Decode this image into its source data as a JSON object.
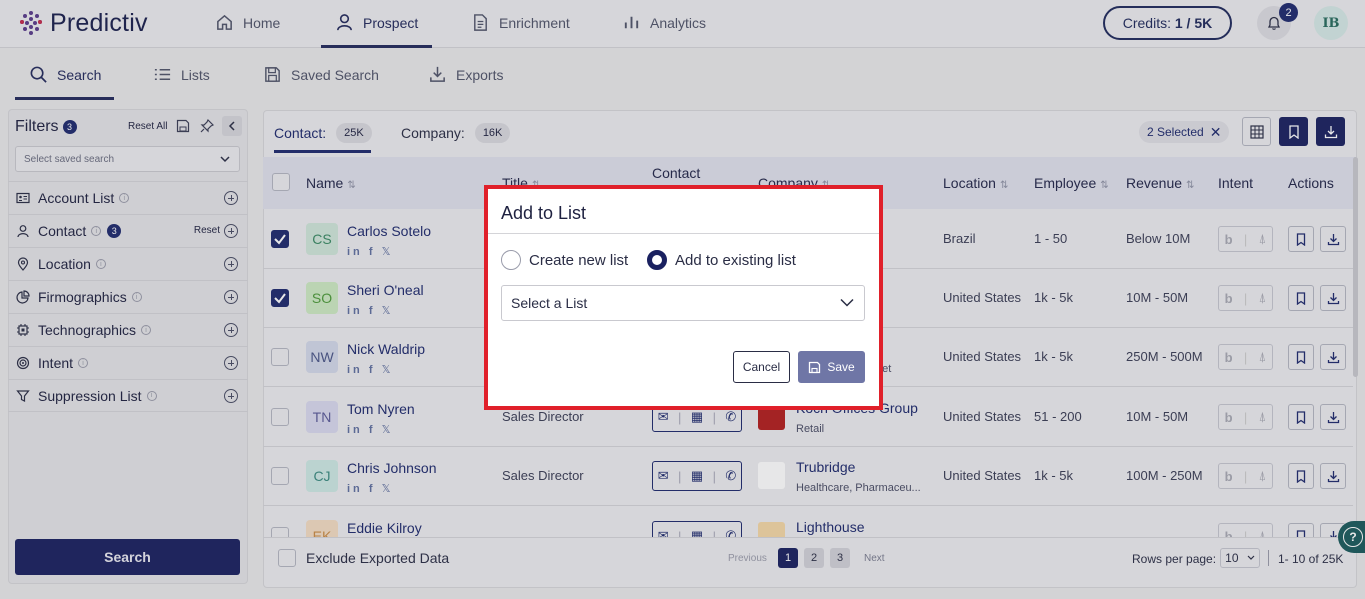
{
  "brand": {
    "name": "Predictiv"
  },
  "nav": {
    "home": "Home",
    "prospect": "Prospect",
    "enrichment": "Enrichment",
    "analytics": "Analytics"
  },
  "credits": {
    "label": "Credits:",
    "value": "1 / 5K"
  },
  "notifications": {
    "count": "2"
  },
  "user": {
    "initials": "IB"
  },
  "subnav": {
    "search": "Search",
    "lists": "Lists",
    "saved_search": "Saved Search",
    "exports": "Exports"
  },
  "filters": {
    "title": "Filters",
    "count": "3",
    "reset_all": "Reset All",
    "saved_placeholder": "Select saved search",
    "items": [
      {
        "label": "Account List",
        "icon": "id-card-icon"
      },
      {
        "label": "Contact",
        "icon": "person-icon",
        "count": "3",
        "reset": "Reset"
      },
      {
        "label": "Location",
        "icon": "pin-icon"
      },
      {
        "label": "Firmographics",
        "icon": "pie-chart-icon"
      },
      {
        "label": "Technographics",
        "icon": "chip-icon"
      },
      {
        "label": "Intent",
        "icon": "target-icon"
      },
      {
        "label": "Suppression List",
        "icon": "filter-icon"
      }
    ],
    "search_button": "Search"
  },
  "tabs": {
    "contact_label": "Contact:",
    "contact_count": "25K",
    "company_label": "Company:",
    "company_count": "16K"
  },
  "selected": {
    "label": "2 Selected"
  },
  "table": {
    "columns": [
      "Name",
      "Title",
      "Contact",
      "Company",
      "Location",
      "Employee",
      "Revenue",
      "Intent",
      "Actions"
    ],
    "contact_col_sub": "",
    "rows": [
      {
        "initials": "CS",
        "name": "Carlos Sotelo",
        "title": "",
        "company": "",
        "industry": "",
        "location": "Brazil",
        "employee": "1 - 50",
        "revenue": "Below 10M",
        "checked": true,
        "avatar_bg": "#cfe6da",
        "avatar_fg": "#3a8a64"
      },
      {
        "initials": "SO",
        "name": "Sheri O'neal",
        "title": "",
        "company": "",
        "industry": "",
        "location": "United States",
        "employee": "1k - 5k",
        "revenue": "10M - 50M",
        "checked": true,
        "avatar_bg": "#cdeac3",
        "avatar_fg": "#4d9a3a"
      },
      {
        "initials": "NW",
        "name": "Nick Waldrip",
        "title": "",
        "company": "",
        "industry": "net",
        "location": "United States",
        "employee": "1k - 5k",
        "revenue": "250M - 500M",
        "checked": false,
        "avatar_bg": "#d3d8ea",
        "avatar_fg": "#4a5688"
      },
      {
        "initials": "TN",
        "name": "Tom Nyren",
        "title": "Sales Director",
        "company": "Koch Offices Group",
        "industry": "Retail",
        "location": "United States",
        "employee": "51 - 200",
        "revenue": "10M - 50M",
        "checked": false,
        "avatar_bg": "#d8d8ee",
        "avatar_fg": "#5a5a99"
      },
      {
        "initials": "CJ",
        "name": "Chris Johnson",
        "title": "Sales Director",
        "company": "Trubridge",
        "industry": "Healthcare, Pharmaceu...",
        "location": "United States",
        "employee": "1k - 5k",
        "revenue": "100M - 250M",
        "checked": false,
        "avatar_bg": "#cde8e4",
        "avatar_fg": "#3a8a80"
      },
      {
        "initials": "EK",
        "name": "Eddie Kilroy",
        "title": "",
        "company": "Lighthouse",
        "industry": "",
        "location": "",
        "employee": "",
        "revenue": "",
        "checked": false,
        "avatar_bg": "#f3dcc3",
        "avatar_fg": "#c98b45"
      }
    ]
  },
  "footer": {
    "exclude_label": "Exclude Exported Data",
    "previous": "Previous",
    "next": "Next",
    "pages": [
      "1",
      "2",
      "3"
    ],
    "rows_per_page_label": "Rows per page:",
    "rows_per_page_value": "10",
    "range": "1- 10 of 25K"
  },
  "modal": {
    "title": "Add to List",
    "option_new": "Create new list",
    "option_existing": "Add to existing list",
    "selected_option": "existing",
    "select_placeholder": "Select a List",
    "cancel": "Cancel",
    "save": "Save"
  },
  "colors": {
    "brand_dark": "#1a2160",
    "highlight_border": "#e0202a",
    "save_button": "#6f76a6"
  }
}
